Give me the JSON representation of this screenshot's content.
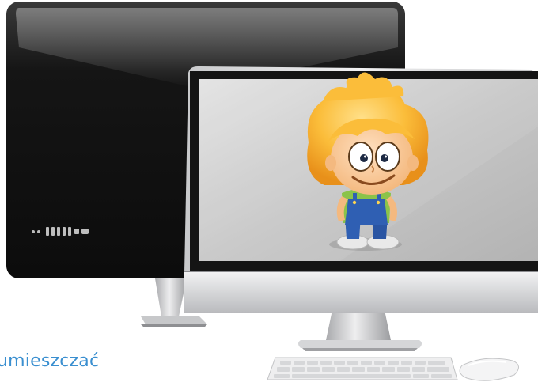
{
  "caption": {
    "text": "umieszczać"
  },
  "colors": {
    "caption": "#3a8fd0",
    "back_monitor_body": "#121212",
    "front_bezel": "#1a1a1a",
    "screen_gray": "#c9c9c9",
    "silver_chin": "#d9dadc",
    "character_hair": "#f5a623",
    "character_shirt": "#8bc34a",
    "character_overalls": "#2f5fb3"
  },
  "icons": {
    "back_ports": "ports-icon",
    "character": "cartoon-boy-icon",
    "keyboard": "keyboard-icon",
    "mouse": "mouse-icon"
  }
}
